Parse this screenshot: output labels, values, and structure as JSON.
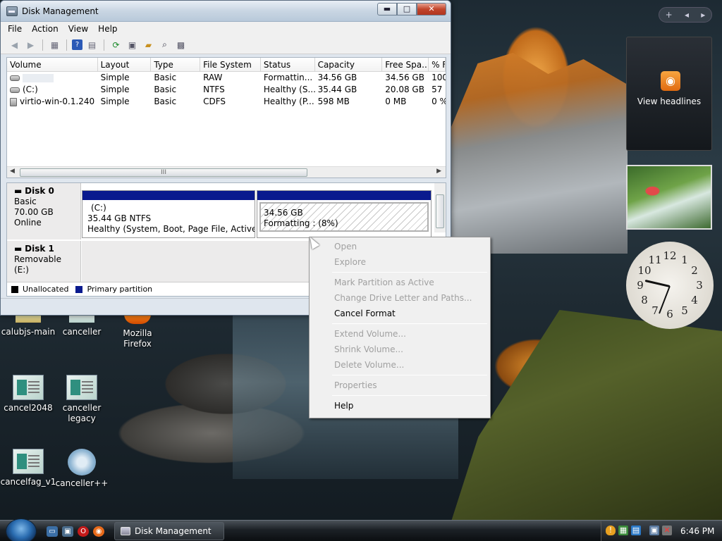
{
  "window": {
    "title": "Disk Management",
    "controls": {
      "minimize": "▬",
      "maximize": "□",
      "close": "✕"
    }
  },
  "menu": [
    "File",
    "Action",
    "View",
    "Help"
  ],
  "volume_list": {
    "columns": [
      "Volume",
      "Layout",
      "Type",
      "File System",
      "Status",
      "Capacity",
      "Free Spa...",
      "% F"
    ],
    "rows": [
      {
        "volume": "",
        "layout": "Simple",
        "type": "Basic",
        "fs": "RAW",
        "status": "Formattin...",
        "capacity": "34.56 GB",
        "free": "34.56 GB",
        "pct": "100"
      },
      {
        "volume": "(C:)",
        "layout": "Simple",
        "type": "Basic",
        "fs": "NTFS",
        "status": "Healthy (S...",
        "capacity": "35.44 GB",
        "free": "20.08 GB",
        "pct": "57"
      },
      {
        "volume": "virtio-win-0.1.240 ...",
        "layout": "Simple",
        "type": "Basic",
        "fs": "CDFS",
        "status": "Healthy (P...",
        "capacity": "598 MB",
        "free": "0 MB",
        "pct": "0 %"
      }
    ],
    "scroll_grip": "III"
  },
  "disks": [
    {
      "name": "Disk 0",
      "type": "Basic",
      "size": "70.00 GB",
      "state": "Online",
      "partitions": [
        {
          "title": "(C:)",
          "line1": "35.44 GB NTFS",
          "line2": "Healthy (System, Boot, Page File, Active, Cra"
        },
        {
          "title": "",
          "line1": "34.56 GB",
          "line2": "Formatting : (8%)"
        }
      ]
    },
    {
      "name": "Disk 1",
      "type": "Removable (E:)"
    }
  ],
  "legend": [
    {
      "label": "Unallocated",
      "color": "#000000"
    },
    {
      "label": "Primary partition",
      "color": "#0a1a8e"
    }
  ],
  "context_menu": [
    {
      "label": "Open",
      "enabled": false
    },
    {
      "label": "Explore",
      "enabled": false
    },
    {
      "sep": true
    },
    {
      "label": "Mark Partition as Active",
      "enabled": false
    },
    {
      "label": "Change Drive Letter and Paths...",
      "enabled": false
    },
    {
      "label": "Cancel Format",
      "enabled": true
    },
    {
      "sep": true
    },
    {
      "label": "Extend Volume...",
      "enabled": false
    },
    {
      "label": "Shrink Volume...",
      "enabled": false
    },
    {
      "label": "Delete Volume...",
      "enabled": false
    },
    {
      "sep": true
    },
    {
      "label": "Properties",
      "enabled": false
    },
    {
      "sep": true
    },
    {
      "label": "Help",
      "enabled": true
    }
  ],
  "desktop_icons": [
    {
      "label": "calubjs-main",
      "kind": "partial"
    },
    {
      "label": "canceller",
      "kind": "partial"
    },
    {
      "label": "Mozilla Firefox",
      "kind": "firefox"
    },
    {
      "label": "cancel2048",
      "kind": "doc"
    },
    {
      "label": "canceller legacy",
      "kind": "doc"
    },
    {
      "label": "cancelfag_v1",
      "kind": "doc"
    },
    {
      "label": "canceller++",
      "kind": "gear"
    }
  ],
  "gadgets": {
    "controls": [
      "+",
      "◂",
      "▸"
    ],
    "rss_text": "View headlines",
    "clock_numbers": [
      "12",
      "1",
      "2",
      "3",
      "4",
      "5",
      "6",
      "7",
      "8",
      "9",
      "10",
      "11"
    ]
  },
  "taskbar": {
    "task_label": "Disk Management",
    "time": "6:46 PM"
  }
}
